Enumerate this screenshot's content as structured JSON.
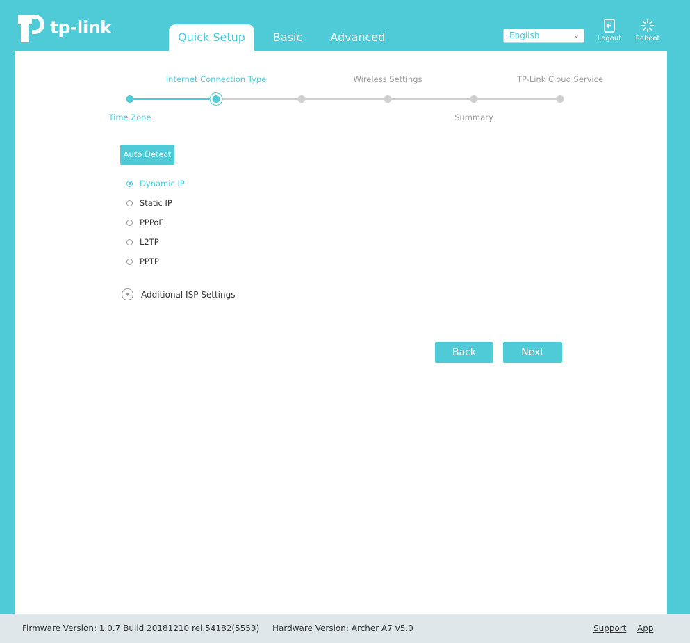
{
  "brand": {
    "name": "tp-link"
  },
  "tabs": [
    {
      "label": "Quick Setup",
      "active": true
    },
    {
      "label": "Basic",
      "active": false
    },
    {
      "label": "Advanced",
      "active": false
    }
  ],
  "language": {
    "selected": "English"
  },
  "header_buttons": {
    "logout": "Logout",
    "reboot": "Reboot"
  },
  "progress": {
    "steps": [
      {
        "label": "Time Zone",
        "state": "done"
      },
      {
        "label": "Internet Connection Type",
        "state": "current"
      },
      {
        "label": "Wireless Settings",
        "state": "todo"
      },
      {
        "label": "",
        "state": "todo"
      },
      {
        "label": "Summary",
        "state": "todo"
      },
      {
        "label": "TP-Link Cloud Service",
        "state": "todo"
      }
    ]
  },
  "connection": {
    "auto_detect_label": "Auto Detect",
    "options": [
      {
        "label": "Dynamic IP",
        "checked": true
      },
      {
        "label": "Static IP",
        "checked": false
      },
      {
        "label": "PPPoE",
        "checked": false
      },
      {
        "label": "L2TP",
        "checked": false
      },
      {
        "label": "PPTP",
        "checked": false
      }
    ],
    "additional_isp_label": "Additional ISP Settings"
  },
  "actions": {
    "back": "Back",
    "next": "Next"
  },
  "footer": {
    "firmware": "Firmware Version: 1.0.7 Build 20181210 rel.54182(5553)",
    "hardware": "Hardware Version: Archer A7 v5.0",
    "support": "Support",
    "app": "App"
  },
  "colors": {
    "accent": "#4ecbd6",
    "panel": "#ffffff",
    "footer": "#dfe7ea",
    "inactive_step": "#cfcfcf"
  },
  "icons": {
    "logo": "tp-link-logo",
    "logout": "logout-icon",
    "reboot": "reboot-icon",
    "expand": "chevron-down-circle-icon"
  }
}
